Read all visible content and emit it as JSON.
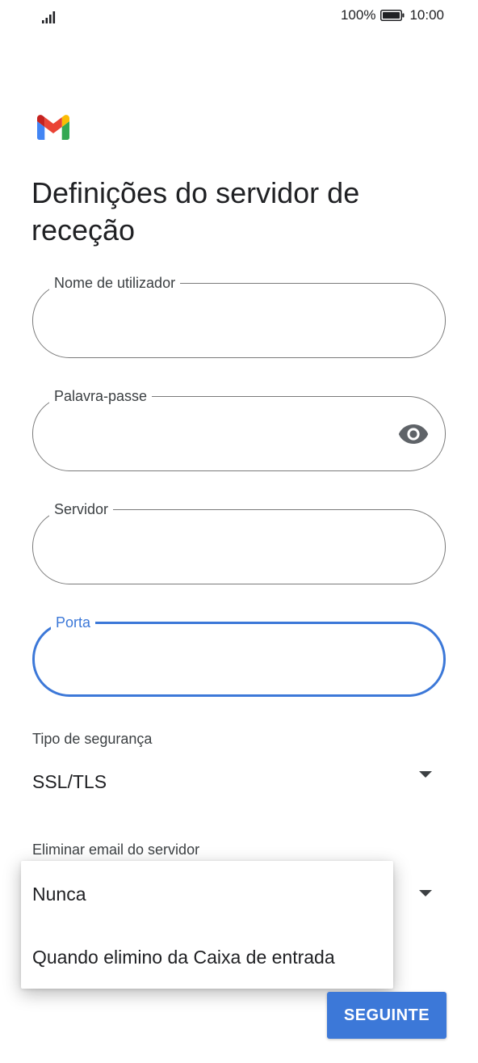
{
  "status_bar": {
    "battery": "100%",
    "time": "10:00",
    "icons": [
      "signal-icon",
      "battery-icon"
    ]
  },
  "app": {
    "logo": "gmail-logo-icon",
    "colors": {
      "accent": "#3c78d8",
      "outline": "#7a7a7a",
      "text": "#202124",
      "gmail_red": "#ea4335",
      "gmail_blue": "#4285f4",
      "gmail_green": "#34a853",
      "gmail_yellow": "#fbbc04"
    }
  },
  "page": {
    "title": "Definições do servidor de receção"
  },
  "form": {
    "username": {
      "label": "Nome de utilizador",
      "value": ""
    },
    "password": {
      "label": "Palavra-passe",
      "value": "",
      "icon": "eye-icon"
    },
    "server": {
      "label": "Servidor",
      "value": ""
    },
    "port": {
      "label": "Porta",
      "value": ""
    }
  },
  "security": {
    "label": "Tipo de segurança",
    "value": "SSL/TLS"
  },
  "delete_email": {
    "label": "Eliminar email do servidor",
    "options": [
      "Nunca",
      "Quando elimino da Caixa de entrada"
    ]
  },
  "actions": {
    "next_label": "SEGUINTE"
  }
}
